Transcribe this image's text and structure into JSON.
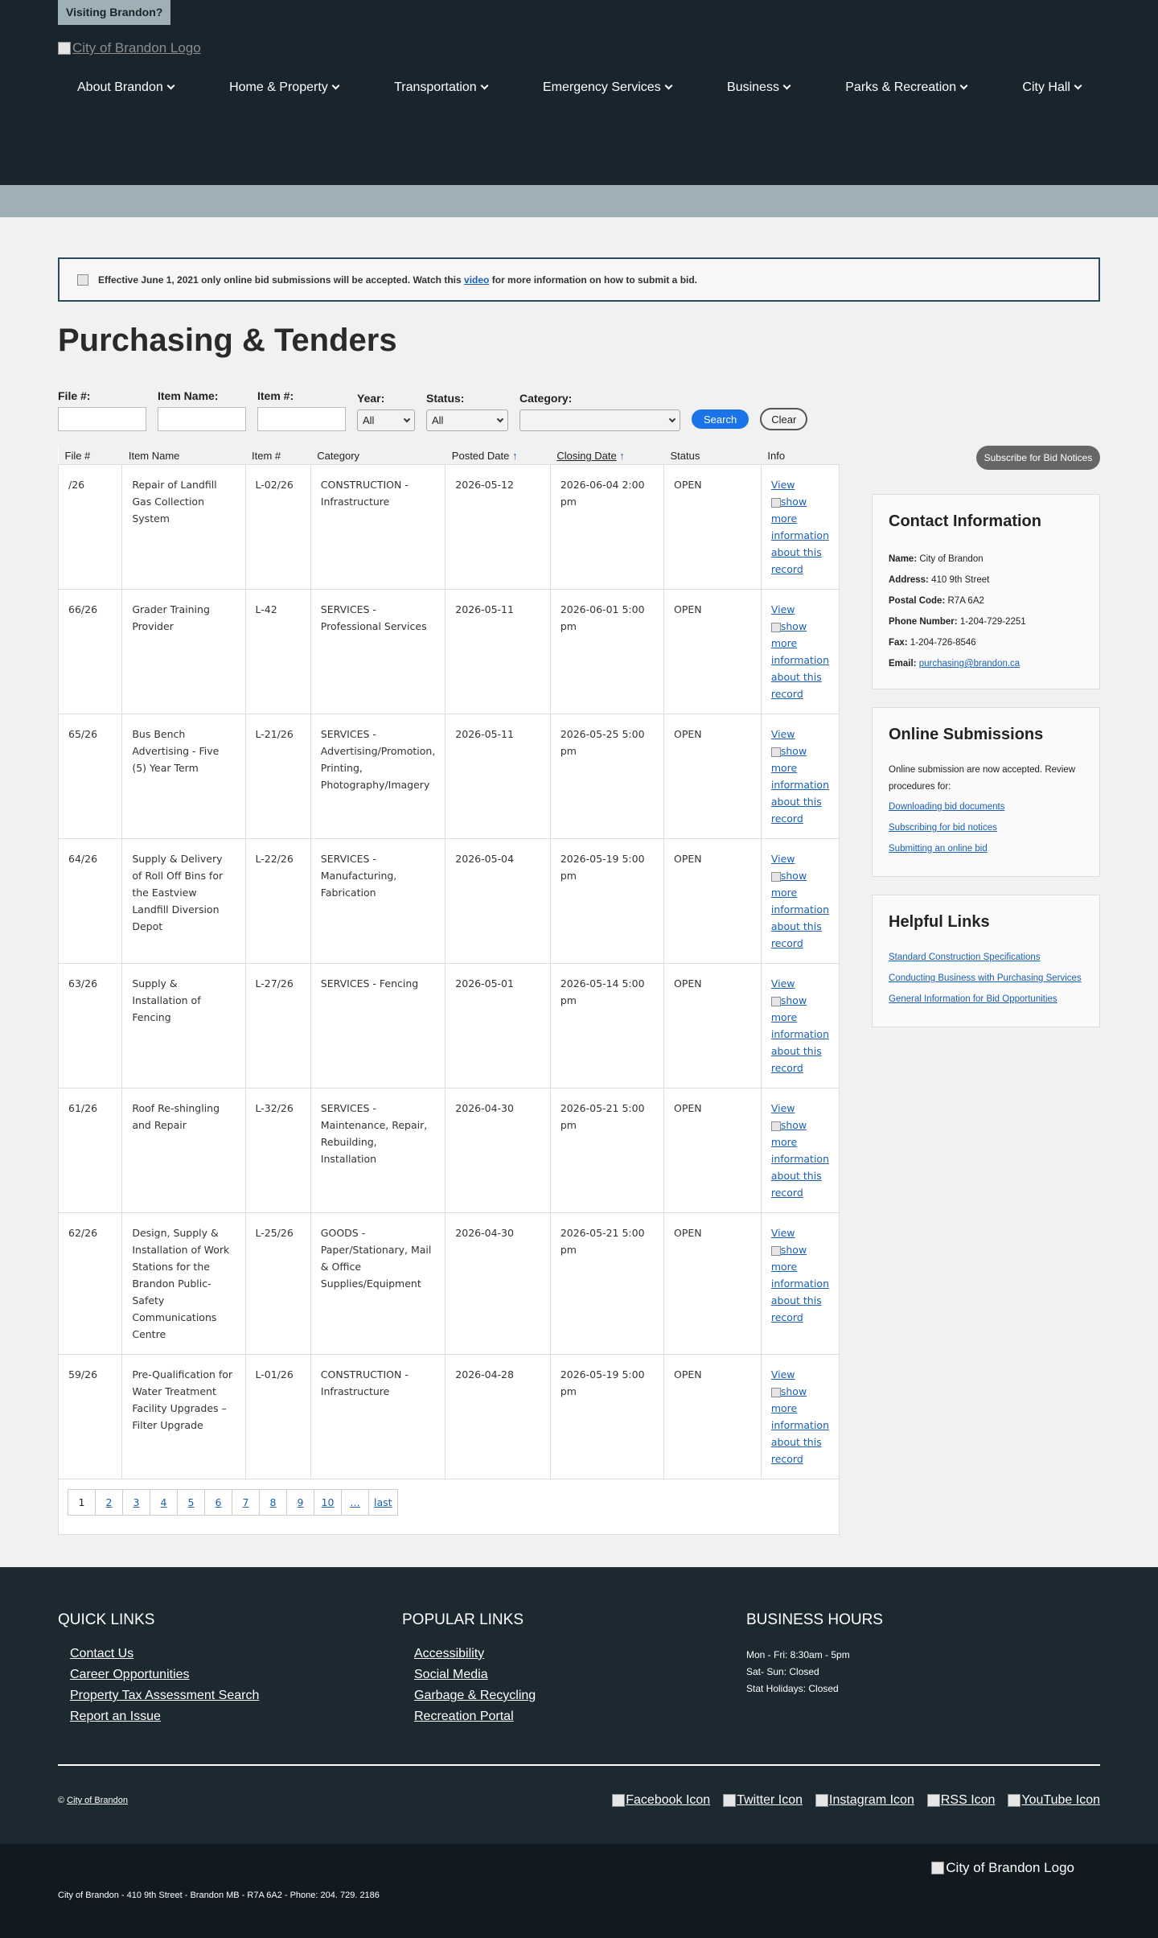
{
  "header": {
    "visiting": "Visiting Brandon?",
    "logo_alt": "City of Brandon Logo",
    "nav": [
      "About Brandon",
      "Home & Property",
      "Transportation",
      "Emergency Services",
      "Business",
      "Parks & Recreation",
      "City Hall"
    ]
  },
  "notice": {
    "before": "Effective June 1, 2021 only online bid submissions will be accepted. Watch this ",
    "link": "video",
    "after": " for more information on how to submit a bid."
  },
  "page_title": "Purchasing & Tenders",
  "filters": {
    "file_label": "File #:",
    "item_name_label": "Item Name:",
    "item_num_label": "Item #:",
    "year_label": "Year:",
    "year_value": "All",
    "status_label": "Status:",
    "status_value": "All",
    "category_label": "Category:",
    "category_value": "",
    "search_button": "Search",
    "clear_button": "Clear"
  },
  "subscribe_button": "Subscribe for Bid Notices",
  "table": {
    "headers": {
      "file": "File #",
      "item_name": "Item Name",
      "item_num": "Item #",
      "category": "Category",
      "posted": "Posted Date",
      "closing": "Closing Date",
      "status": "Status",
      "info": "Info"
    },
    "sort_arrow": "↑",
    "view_label": "View",
    "more_info_alt": "show more information about this record",
    "rows": [
      {
        "file": "/26",
        "item_name": "Repair of Landfill Gas Collection System",
        "item_num": "L-02/26",
        "category": "CONSTRUCTION - Infrastructure",
        "posted": "2026-05-12",
        "closing": "2026-06-04 2:00 pm",
        "status": "OPEN"
      },
      {
        "file": "66/26",
        "item_name": "Grader Training Provider",
        "item_num": "L-42",
        "category": "SERVICES - Professional Services",
        "posted": "2026-05-11",
        "closing": "2026-06-01 5:00 pm",
        "status": "OPEN"
      },
      {
        "file": "65/26",
        "item_name": "Bus Bench Advertising - Five (5) Year Term",
        "item_num": "L-21/26",
        "category": "SERVICES - Advertising/Promotion, Printing, Photography/Imagery",
        "posted": "2026-05-11",
        "closing": "2026-05-25 5:00 pm",
        "status": "OPEN"
      },
      {
        "file": "64/26",
        "item_name": "Supply & Delivery of Roll Off Bins for the Eastview Landfill Diversion Depot",
        "item_num": "L-22/26",
        "category": "SERVICES - Manufacturing, Fabrication",
        "posted": "2026-05-04",
        "closing": "2026-05-19 5:00 pm",
        "status": "OPEN"
      },
      {
        "file": "63/26",
        "item_name": "Supply & Installation of Fencing",
        "item_num": "L-27/26",
        "category": "SERVICES - Fencing",
        "posted": "2026-05-01",
        "closing": "2026-05-14 5:00 pm",
        "status": "OPEN"
      },
      {
        "file": "61/26",
        "item_name": "Roof Re-shingling and Repair",
        "item_num": "L-32/26",
        "category": "SERVICES - Maintenance, Repair, Rebuilding, Installation",
        "posted": "2026-04-30",
        "closing": "2026-05-21 5:00 pm",
        "status": "OPEN"
      },
      {
        "file": "62/26",
        "item_name": "Design, Supply & Installation of Work Stations for the Brandon Public-Safety Communications Centre",
        "item_num": "L-25/26",
        "category": "GOODS - Paper/Stationary, Mail & Office Supplies/Equipment",
        "posted": "2026-04-30",
        "closing": "2026-05-21 5:00 pm",
        "status": "OPEN"
      },
      {
        "file": "59/26",
        "item_name": "Pre-Qualification for Water Treatment Facility Upgrades – Filter Upgrade",
        "item_num": "L-01/26",
        "category": "CONSTRUCTION - Infrastructure",
        "posted": "2026-04-28",
        "closing": "2026-05-19 5:00 pm",
        "status": "OPEN"
      }
    ],
    "pager": [
      "1",
      "2",
      "3",
      "4",
      "5",
      "6",
      "7",
      "8",
      "9",
      "10",
      "…",
      "last"
    ]
  },
  "contact": {
    "title": "Contact Information",
    "name_label": "Name:",
    "name": "City of Brandon",
    "address_label": "Address:",
    "address": "410 9th Street",
    "postal_label": "Postal Code:",
    "postal": "R7A 6A2",
    "phone_label": "Phone Number:",
    "phone": "1-204-729-2251",
    "fax_label": "Fax:",
    "fax": "1-204-726-8546",
    "email_label": "Email:",
    "email": "purchasing@brandon.ca"
  },
  "online": {
    "title": "Online Submissions",
    "intro": "Online submission are now accepted. Review procedures for:",
    "links": [
      "Downloading bid documents",
      "Subscribing for bid notices",
      "Submitting an online bid"
    ]
  },
  "helpful": {
    "title": "Helpful Links",
    "links": [
      "Standard Construction Specifications",
      "Conducting Business with Purchasing Services",
      "General Information for Bid Opportunities"
    ]
  },
  "footer": {
    "quick_title": "QUICK LINKS",
    "quick_links": [
      "Contact Us",
      "Career Opportunities",
      "Property Tax Assessment Search",
      "Report an Issue"
    ],
    "popular_title": "POPULAR LINKS",
    "popular_links": [
      "Accessibility",
      "Social Media",
      "Garbage & Recycling",
      "Recreation Portal"
    ],
    "hours_title": "BUSINESS HOURS",
    "hours": [
      "Mon - Fri: 8:30am - 5pm",
      "Sat- Sun: Closed",
      "Stat Holidays: Closed"
    ],
    "copyright_symbol": "© ",
    "copyright_link": "City of Brandon",
    "social": [
      "Facebook Icon",
      "Twitter Icon",
      "Instagram Icon",
      "RSS Icon",
      "YouTube Icon"
    ],
    "address": "City of Brandon - 410 9th Street - Brandon MB - R7A 6A2 - Phone: 204. 729. 2186",
    "logo_alt": "City of Brandon Logo"
  }
}
